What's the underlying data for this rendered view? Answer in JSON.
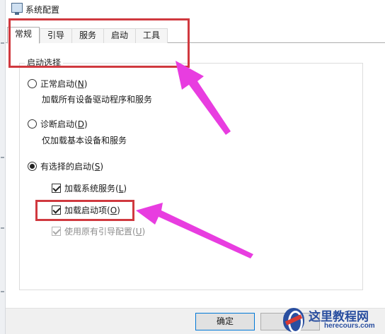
{
  "window": {
    "title": "系统配置",
    "icon": "system-config-icon"
  },
  "tabs": [
    {
      "label": "常规",
      "active": true
    },
    {
      "label": "引导",
      "active": false
    },
    {
      "label": "服务",
      "active": false
    },
    {
      "label": "启动",
      "active": false
    },
    {
      "label": "工具",
      "active": false
    }
  ],
  "startup": {
    "group_label": "启动选择",
    "normal": {
      "label": "正常启动",
      "hotkey": "N",
      "desc": "加载所有设备驱动程序和服务",
      "selected": false
    },
    "diagnostic": {
      "label": "诊断启动",
      "hotkey": "D",
      "desc": "仅加载基本设备和服务",
      "selected": false
    },
    "selective": {
      "label": "有选择的启动",
      "hotkey": "S",
      "selected": true
    },
    "options": {
      "load_services": {
        "label": "加载系统服务",
        "hotkey": "L",
        "checked": true,
        "enabled": true
      },
      "load_startup": {
        "label": "加载启动项",
        "hotkey": "O",
        "checked": true,
        "enabled": true
      },
      "use_original_boot": {
        "label": "使用原有引导配置",
        "hotkey": "U",
        "checked": true,
        "enabled": false
      }
    }
  },
  "footer": {
    "ok_label": "确定"
  },
  "annotations": {
    "highlight_color": "#d0393f",
    "arrow_color": "#e83de0"
  },
  "watermark": {
    "site": "这里教程网",
    "domain": "herecours.com"
  }
}
